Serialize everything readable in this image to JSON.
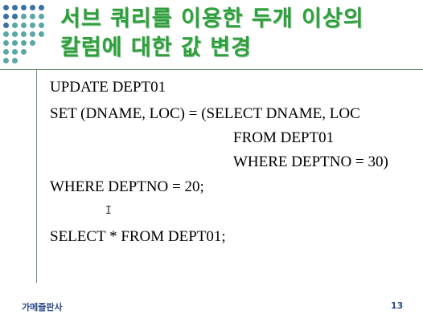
{
  "title": {
    "line1": "서브 쿼리를 이용한 두개 이상의",
    "line2": "칼럼에 대한 값 변경"
  },
  "code_lines": [
    "UPDATE DEPT01",
    "SET (DNAME, LOC) = (SELECT DNAME, LOC",
    "FROM DEPT01",
    "WHERE DEPTNO = 30)",
    "WHERE DEPTNO = 20;",
    "SELECT * FROM DEPT01;"
  ],
  "footer": {
    "left": "가메즐판사",
    "page_number": "13"
  },
  "colors": {
    "title": "#2f9f3d",
    "dot_teal": "#5aa7a8",
    "dot_blue": "#3b6fa6",
    "footer": "#2e4a8a"
  }
}
